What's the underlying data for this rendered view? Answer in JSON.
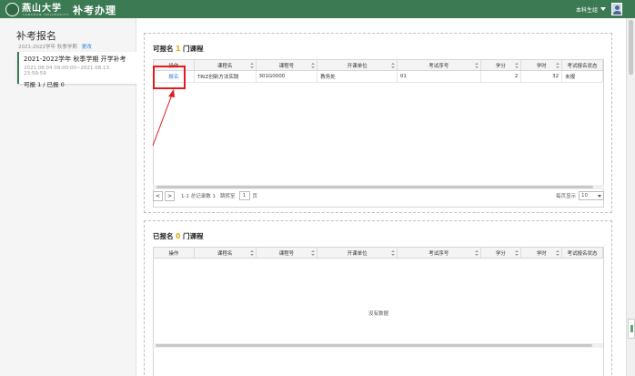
{
  "header": {
    "logo_text": "燕山大学",
    "logo_sub": "YANSHAN UNIVERSITY",
    "app_title": "补考办理",
    "user_label": "本科生组"
  },
  "sidebar": {
    "title": "补考报名",
    "term": "2021-2022学年 秋季学期",
    "change_link": "更改",
    "card": {
      "title": "2021-2022学年 秋季学期 开学补考",
      "time": "2021.08.04 09:00:00~2021.08.13 23:59:59",
      "count": "可报 1 / 已报 0"
    }
  },
  "available": {
    "title_prefix": "可报名 ",
    "count": "1",
    "title_suffix": " 门课程",
    "columns": [
      "操作",
      "课程名",
      "课程号",
      "开课单位",
      "考试序号",
      "学分",
      "学时",
      "考试报名状态"
    ],
    "rows": [
      {
        "action": "报名",
        "course_name": "TRIZ创新方法实践",
        "course_no": "301G0000",
        "unit": "教务处",
        "exam_no": "01",
        "credit": "2",
        "hours": "32",
        "status": "未报"
      }
    ],
    "pager": {
      "prev": "<",
      "next": ">",
      "summary": "1-1 总记录数 1",
      "jump_label": "跳转至",
      "page_value": "1",
      "page_unit": "页",
      "per_page_label": "每页显示",
      "per_page_value": "10"
    }
  },
  "registered": {
    "title_prefix": "已报名 ",
    "count": "0",
    "title_suffix": " 门课程",
    "columns": [
      "操作",
      "课程名",
      "课程号",
      "开课单位",
      "考试序号",
      "学分",
      "学时",
      "考试报名状态"
    ],
    "empty_text": "没有数据"
  },
  "colors": {
    "brand": "#3c7a53",
    "highlight": "#e01c1c",
    "count": "#e0a800",
    "link": "#2a7fd4"
  }
}
